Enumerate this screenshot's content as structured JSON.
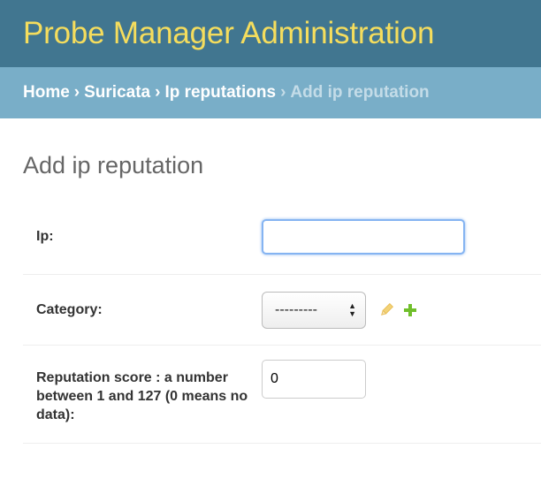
{
  "header": {
    "site_name": "Probe Manager Administration"
  },
  "breadcrumbs": {
    "home": "Home",
    "separator": "›",
    "app": "Suricata",
    "model": "Ip reputations",
    "current": "Add ip reputation"
  },
  "page": {
    "title": "Add ip reputation"
  },
  "form": {
    "ip": {
      "label": "Ip:",
      "value": ""
    },
    "category": {
      "label": "Category:",
      "selected": "---------",
      "edit_icon": "pencil-icon",
      "add_icon": "plus-icon"
    },
    "reputation_score": {
      "label": "Reputation score : a number between 1 and 127 (0 means no data):",
      "value": "0"
    }
  },
  "colors": {
    "header_bg": "#417690",
    "site_name": "#f5dd5d",
    "breadcrumbs_bg": "#79aec8",
    "add_icon": "#70bf2b",
    "edit_icon": "#efb80b"
  }
}
